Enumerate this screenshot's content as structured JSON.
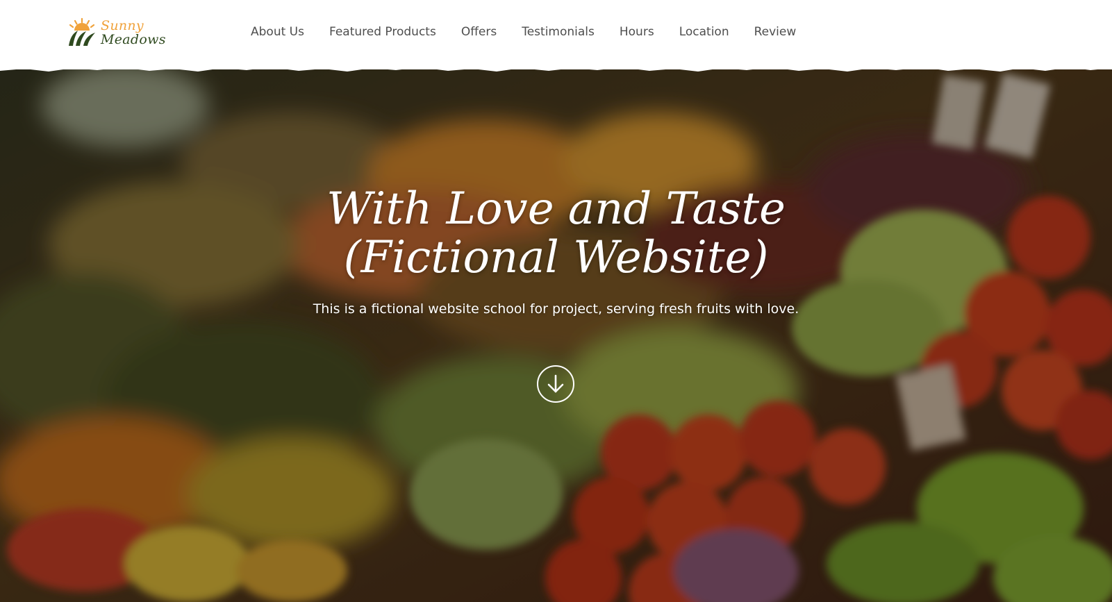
{
  "brand": {
    "name_line1": "Sunny",
    "name_line2": "Meadows",
    "icon": "sun-over-leaves-icon",
    "colors": {
      "accent": "#f0a23b",
      "dark": "#2f4a1f"
    }
  },
  "nav": {
    "items": [
      {
        "label": "About Us"
      },
      {
        "label": "Featured Products"
      },
      {
        "label": "Offers"
      },
      {
        "label": "Testimonials"
      },
      {
        "label": "Hours"
      },
      {
        "label": "Location"
      },
      {
        "label": "Review"
      }
    ],
    "text_color": "#4e4e4e"
  },
  "hero": {
    "title": "With Love and Taste (Fictional Website)",
    "subtitle": "This is a fictional website school for project, serving fresh fruits with love.",
    "scroll_icon": "arrow-down-circle-icon",
    "background": "blurred-fruit-market-photo"
  }
}
